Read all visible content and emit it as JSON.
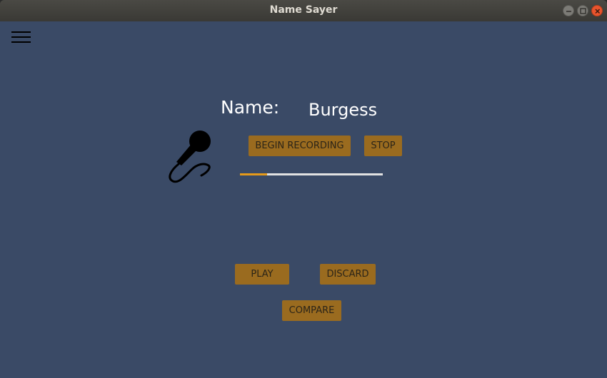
{
  "window": {
    "title": "Name Sayer"
  },
  "menu": {
    "icon": "hamburger-menu-icon"
  },
  "name_section": {
    "label": "Name:",
    "value": "Burgess"
  },
  "recording": {
    "icon": "microphone-icon",
    "begin_label": "BEGIN RECORDING",
    "stop_label": "STOP",
    "progress_fraction": 0.19
  },
  "playback": {
    "play_label": "PLAY",
    "discard_label": "DISCARD",
    "compare_label": "COMPARE"
  },
  "colors": {
    "background": "#3a4a66",
    "button": "#9a6b1f",
    "progress_fill": "#e59a1a",
    "progress_track": "#e2e2e2"
  }
}
